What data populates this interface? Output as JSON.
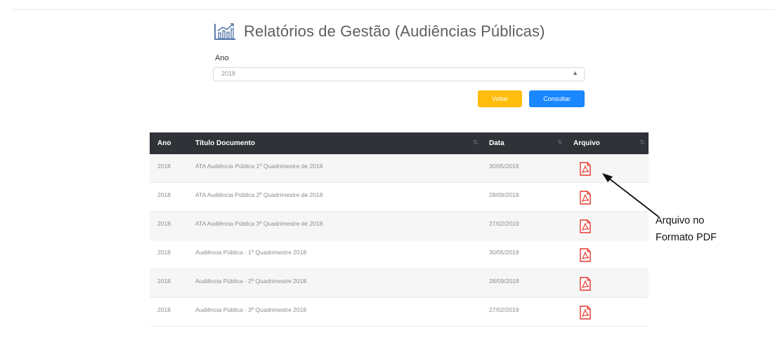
{
  "header": {
    "title": "Relatórios de Gestão (Audiências Públicas)",
    "title_icon": "line-chart-icon"
  },
  "filter": {
    "ano_label": "Ano",
    "ano_value": "2018",
    "caret": "▲▼"
  },
  "buttons": {
    "voltar": "Voltar",
    "consultar": "Consultar"
  },
  "table": {
    "headers": [
      "Ano",
      "Título Documento",
      "Data",
      "Arquivo"
    ],
    "rows": [
      {
        "ano": "2018",
        "titulo": "ATA Audiência Pública 1º Quadrimestre de 2018",
        "data": "30/05/2018",
        "arquivo_icon": "pdf-icon"
      },
      {
        "ano": "2018",
        "titulo": "ATA Audiência Pública 2º Quadrimestre de 2018",
        "data": "28/09/2018",
        "arquivo_icon": "pdf-icon"
      },
      {
        "ano": "2018",
        "titulo": "ATA Audiência Pública 3º Quadrimestre de 2018",
        "data": "27/02/2019",
        "arquivo_icon": "pdf-icon"
      },
      {
        "ano": "2018",
        "titulo": "Audiência Pública - 1º Quadrimestre 2018",
        "data": "30/05/2018",
        "arquivo_icon": "pdf-icon"
      },
      {
        "ano": "2018",
        "titulo": "Audiência Pública - 2º Quadrimestre 2018",
        "data": "28/09/2018",
        "arquivo_icon": "pdf-icon"
      },
      {
        "ano": "2018",
        "titulo": "Audiência Pública - 3º Quadrimestre 2018",
        "data": "27/02/2019",
        "arquivo_icon": "pdf-icon"
      }
    ]
  },
  "annotation": {
    "line1": "Arquivo no",
    "line2": "Formato PDF"
  },
  "colors": {
    "voltar": "#ffbe0b",
    "consultar": "#1a87ff",
    "table_header": "#2f3237",
    "pdf_red": "#e5352c"
  }
}
